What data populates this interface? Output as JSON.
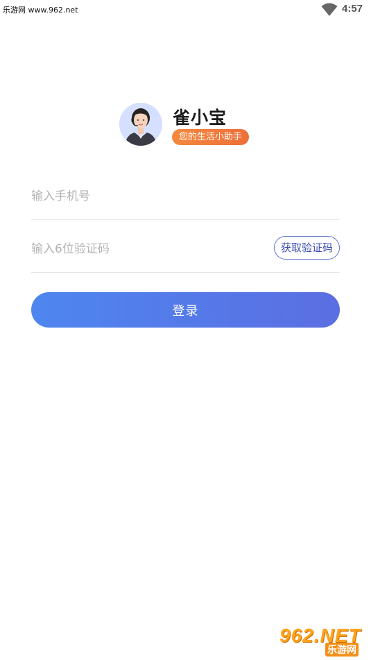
{
  "status_bar": {
    "watermark": "乐游网 www.962.net",
    "time": "4:57",
    "wifi_icon": "wifi-icon"
  },
  "brand": {
    "app_name": "雀小宝",
    "tagline": "您的生活小助手",
    "tagline_color": "#f07d3a"
  },
  "form": {
    "phone_placeholder": "输入手机号",
    "code_placeholder": "输入6位验证码",
    "get_code_label": "获取验证码",
    "login_label": "登录"
  },
  "watermark_bottom": {
    "main": "962.NET",
    "sub": "乐游网"
  },
  "colors": {
    "accent": "#5b6ee2",
    "button_gradient_start": "#4e86ef",
    "button_gradient_end": "#5b6ee2"
  }
}
